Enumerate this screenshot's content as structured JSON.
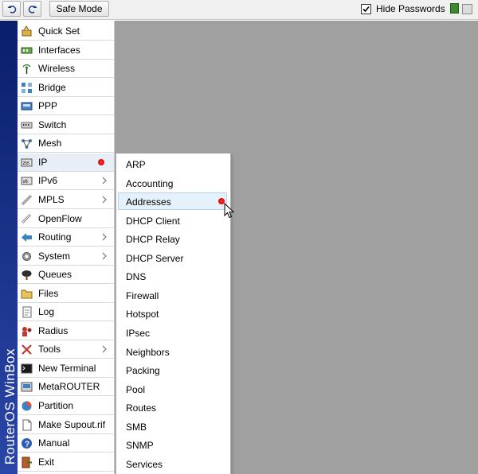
{
  "toolbar": {
    "safe_mode_label": "Safe Mode",
    "hide_passwords_label": "Hide Passwords",
    "hide_passwords_checked": true
  },
  "vertical_title": "RouterOS WinBox",
  "sidebar": {
    "items": [
      {
        "label": "Quick Set",
        "icon": "quick-set-icon"
      },
      {
        "label": "Interfaces",
        "icon": "interfaces-icon"
      },
      {
        "label": "Wireless",
        "icon": "wireless-icon"
      },
      {
        "label": "Bridge",
        "icon": "bridge-icon"
      },
      {
        "label": "PPP",
        "icon": "ppp-icon"
      },
      {
        "label": "Switch",
        "icon": "switch-icon"
      },
      {
        "label": "Mesh",
        "icon": "mesh-icon"
      },
      {
        "label": "IP",
        "icon": "ip-icon",
        "active": true
      },
      {
        "label": "IPv6",
        "icon": "ipv6-icon",
        "submenu": true
      },
      {
        "label": "MPLS",
        "icon": "mpls-icon",
        "submenu": true
      },
      {
        "label": "OpenFlow",
        "icon": "openflow-icon"
      },
      {
        "label": "Routing",
        "icon": "routing-icon",
        "submenu": true
      },
      {
        "label": "System",
        "icon": "system-icon",
        "submenu": true
      },
      {
        "label": "Queues",
        "icon": "queues-icon"
      },
      {
        "label": "Files",
        "icon": "files-icon"
      },
      {
        "label": "Log",
        "icon": "log-icon"
      },
      {
        "label": "Radius",
        "icon": "radius-icon"
      },
      {
        "label": "Tools",
        "icon": "tools-icon",
        "submenu": true
      },
      {
        "label": "New Terminal",
        "icon": "terminal-icon"
      },
      {
        "label": "MetaROUTER",
        "icon": "metarouter-icon"
      },
      {
        "label": "Partition",
        "icon": "partition-icon"
      },
      {
        "label": "Make Supout.rif",
        "icon": "supout-icon"
      },
      {
        "label": "Manual",
        "icon": "manual-icon"
      },
      {
        "label": "Exit",
        "icon": "exit-icon"
      }
    ]
  },
  "ip_submenu": {
    "items": [
      {
        "label": "ARP"
      },
      {
        "label": "Accounting"
      },
      {
        "label": "Addresses",
        "hover": true
      },
      {
        "label": "DHCP Client"
      },
      {
        "label": "DHCP Relay"
      },
      {
        "label": "DHCP Server"
      },
      {
        "label": "DNS"
      },
      {
        "label": "Firewall"
      },
      {
        "label": "Hotspot"
      },
      {
        "label": "IPsec"
      },
      {
        "label": "Neighbors"
      },
      {
        "label": "Packing"
      },
      {
        "label": "Pool"
      },
      {
        "label": "Routes"
      },
      {
        "label": "SMB"
      },
      {
        "label": "SNMP"
      },
      {
        "label": "Services"
      }
    ]
  },
  "colors": {
    "brand_bar": "#1a3590",
    "workspace_bg": "#a0a0a0",
    "highlight_dot": "#e00000"
  }
}
